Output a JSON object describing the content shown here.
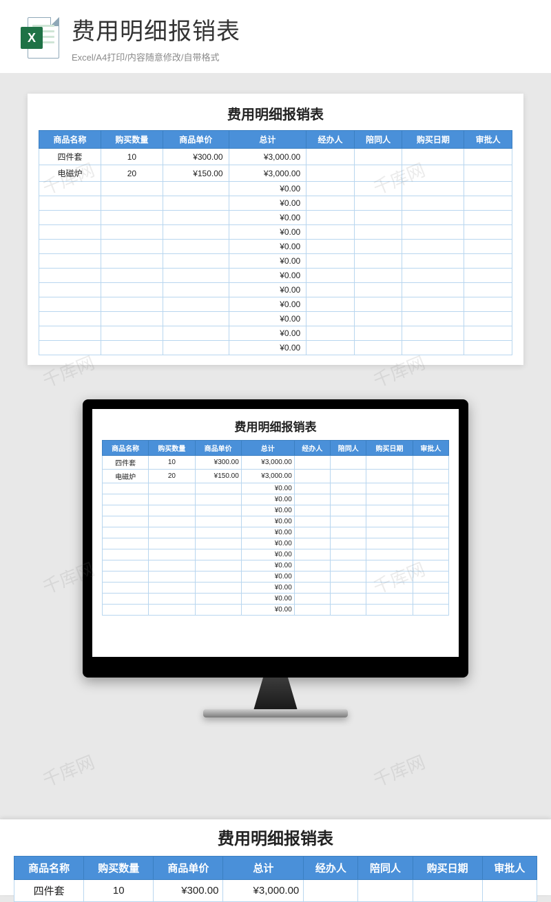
{
  "banner": {
    "icon_letter": "X",
    "title": "费用明细报销表",
    "subtitle": "Excel/A4打印/内容随意修改/自带格式"
  },
  "sheet": {
    "title": "费用明细报销表",
    "headers": [
      "商品名称",
      "购买数量",
      "商品单价",
      "总计",
      "经办人",
      "陪同人",
      "购买日期",
      "审批人"
    ],
    "rows": [
      {
        "name": "四件套",
        "qty": "10",
        "price": "¥300.00",
        "total": "¥3,000.00",
        "handler": "",
        "companion": "",
        "date": "",
        "approver": ""
      },
      {
        "name": "电磁炉",
        "qty": "20",
        "price": "¥150.00",
        "total": "¥3,000.00",
        "handler": "",
        "companion": "",
        "date": "",
        "approver": ""
      },
      {
        "name": "",
        "qty": "",
        "price": "",
        "total": "¥0.00",
        "handler": "",
        "companion": "",
        "date": "",
        "approver": ""
      },
      {
        "name": "",
        "qty": "",
        "price": "",
        "total": "¥0.00",
        "handler": "",
        "companion": "",
        "date": "",
        "approver": ""
      },
      {
        "name": "",
        "qty": "",
        "price": "",
        "total": "¥0.00",
        "handler": "",
        "companion": "",
        "date": "",
        "approver": ""
      },
      {
        "name": "",
        "qty": "",
        "price": "",
        "total": "¥0.00",
        "handler": "",
        "companion": "",
        "date": "",
        "approver": ""
      },
      {
        "name": "",
        "qty": "",
        "price": "",
        "total": "¥0.00",
        "handler": "",
        "companion": "",
        "date": "",
        "approver": ""
      },
      {
        "name": "",
        "qty": "",
        "price": "",
        "total": "¥0.00",
        "handler": "",
        "companion": "",
        "date": "",
        "approver": ""
      },
      {
        "name": "",
        "qty": "",
        "price": "",
        "total": "¥0.00",
        "handler": "",
        "companion": "",
        "date": "",
        "approver": ""
      },
      {
        "name": "",
        "qty": "",
        "price": "",
        "total": "¥0.00",
        "handler": "",
        "companion": "",
        "date": "",
        "approver": ""
      },
      {
        "name": "",
        "qty": "",
        "price": "",
        "total": "¥0.00",
        "handler": "",
        "companion": "",
        "date": "",
        "approver": ""
      },
      {
        "name": "",
        "qty": "",
        "price": "",
        "total": "¥0.00",
        "handler": "",
        "companion": "",
        "date": "",
        "approver": ""
      },
      {
        "name": "",
        "qty": "",
        "price": "",
        "total": "¥0.00",
        "handler": "",
        "companion": "",
        "date": "",
        "approver": ""
      },
      {
        "name": "",
        "qty": "",
        "price": "",
        "total": "¥0.00",
        "handler": "",
        "companion": "",
        "date": "",
        "approver": ""
      }
    ]
  },
  "watermark": "千库网"
}
